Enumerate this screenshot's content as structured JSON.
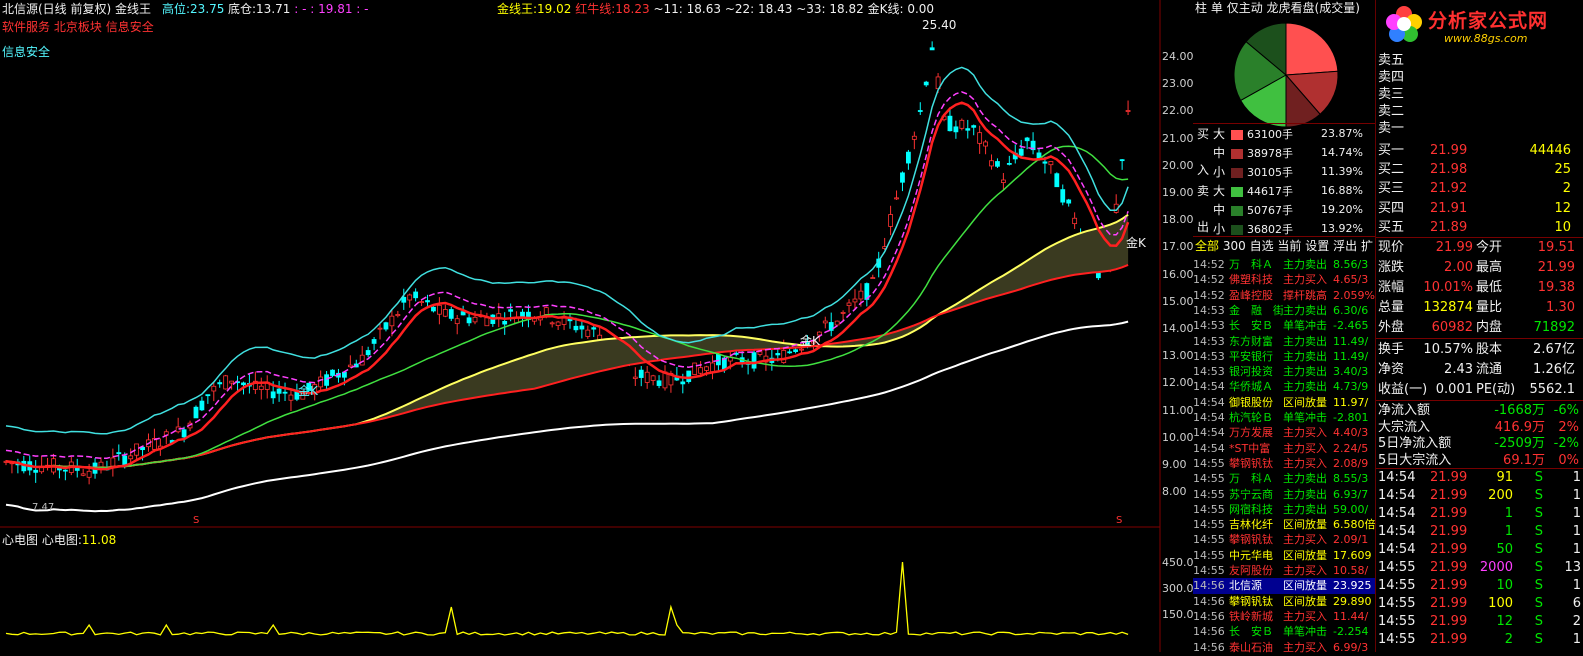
{
  "header": {
    "title": "北信源(日线 前复权) 金线王",
    "high_label": "高位:",
    "high_value": "23.75",
    "low_label": "底仓:",
    "low_value": "13.71",
    "dash_a": ": -",
    "v1981": ": 19.81",
    "dash_b": ": -",
    "gold_label": "金线王:",
    "gold_value": "19.02",
    "red_label": "红牛线:",
    "red_value": "18.23",
    "l11": "~11: 18.63",
    "l22": "~22: 18.43",
    "l33": "~33: 18.82",
    "goldk": "金K线: 0.00",
    "sectors": [
      "软件服务",
      "北京板块",
      "信息安全"
    ],
    "concept": "信息安全"
  },
  "chart": {
    "peak_label": "25.40",
    "low_mark": "7.47",
    "price_ticks": [
      "24.00",
      "23.00",
      "22.00",
      "21.00",
      "20.00",
      "19.00",
      "18.00",
      "17.00",
      "16.00",
      "15.00",
      "14.00",
      "13.00",
      "12.00",
      "11.00",
      "10.00",
      "9.00",
      "8.00"
    ],
    "goldk_labels": [
      "金K",
      "金K",
      "金K"
    ],
    "s_mark": "S",
    "indicator_title": "心电图",
    "indicator_label": "心电图:",
    "indicator_value": "11.08",
    "indicator_ticks": [
      "450.0",
      "300.0",
      "150.0"
    ]
  },
  "panel_tabs": [
    "柱",
    "单",
    "仅主动",
    "龙虎看盘(成交量)"
  ],
  "logo": {
    "name": "分析家公式网",
    "url": "www.88gs.com"
  },
  "money_flow": {
    "buy_side": [
      "买",
      "入"
    ],
    "sell_side": [
      "卖",
      "出"
    ],
    "rows": [
      {
        "size": "大",
        "vol": "63100手",
        "pct": "23.87%",
        "color": "#ff5050"
      },
      {
        "size": "中",
        "vol": "38978手",
        "pct": "14.74%",
        "color": "#b03030"
      },
      {
        "size": "小",
        "vol": "30105手",
        "pct": "11.39%",
        "color": "#702020"
      },
      {
        "size": "大",
        "vol": "44617手",
        "pct": "16.88%",
        "color": "#40c040"
      },
      {
        "size": "中",
        "vol": "50767手",
        "pct": "19.20%",
        "color": "#2a802a"
      },
      {
        "size": "小",
        "vol": "36802手",
        "pct": "13.92%",
        "color": "#1c501c"
      }
    ]
  },
  "filter_tabs": [
    "全部",
    "300",
    "自选",
    "当前",
    "设置",
    "浮出",
    "扩"
  ],
  "radar": [
    {
      "time": "14:52",
      "name": "万　科Ａ",
      "type": "主力卖出",
      "val": "8.56/3",
      "c": "green"
    },
    {
      "time": "14:52",
      "name": "佛塑科技",
      "type": "主力买入",
      "val": "4.65/3",
      "c": "red"
    },
    {
      "time": "14:52",
      "name": "盈峰控股",
      "type": "撑杆跳高",
      "val": "2.059%",
      "c": "red"
    },
    {
      "time": "14:53",
      "name": "金　融　街",
      "type": "主力卖出",
      "val": "6.30/6",
      "c": "green"
    },
    {
      "time": "14:53",
      "name": "长　安Ｂ",
      "type": "单笔冲击",
      "val": "-2.465",
      "c": "green"
    },
    {
      "time": "14:53",
      "name": "东方财富",
      "type": "主力卖出",
      "val": "11.49/",
      "c": "green"
    },
    {
      "time": "14:53",
      "name": "平安银行",
      "type": "主力卖出",
      "val": "11.49/",
      "c": "green"
    },
    {
      "time": "14:53",
      "name": "银河投资",
      "type": "主力卖出",
      "val": "3.40/3",
      "c": "green"
    },
    {
      "time": "14:54",
      "name": "华侨城Ａ",
      "type": "主力卖出",
      "val": "4.73/9",
      "c": "green"
    },
    {
      "time": "14:54",
      "name": "御银股份",
      "type": "区间放量",
      "val": "11.97/",
      "c": "yellow"
    },
    {
      "time": "14:54",
      "name": "杭汽轮Ｂ",
      "type": "单笔冲击",
      "val": "-2.801",
      "c": "green"
    },
    {
      "time": "14:54",
      "name": "万方发展",
      "type": "主力买入",
      "val": "4.40/3",
      "c": "red"
    },
    {
      "time": "14:54",
      "name": "*ST中富",
      "type": "主力买入",
      "val": "2.24/5",
      "c": "red"
    },
    {
      "time": "14:55",
      "name": "攀钢钒钛",
      "type": "主力买入",
      "val": "2.08/9",
      "c": "red"
    },
    {
      "time": "14:55",
      "name": "万　科Ａ",
      "type": "主力卖出",
      "val": "8.55/3",
      "c": "green"
    },
    {
      "time": "14:55",
      "name": "苏宁云商",
      "type": "主力卖出",
      "val": "6.93/7",
      "c": "green"
    },
    {
      "time": "14:55",
      "name": "网宿科技",
      "type": "主力卖出",
      "val": "59.00/",
      "c": "green"
    },
    {
      "time": "14:55",
      "name": "吉林化纤",
      "type": "区间放量",
      "val": "6.580倍",
      "c": "yellow"
    },
    {
      "time": "14:55",
      "name": "攀钢钒钛",
      "type": "主力买入",
      "val": "2.09/1",
      "c": "red"
    },
    {
      "time": "14:55",
      "name": "中元华电",
      "type": "区间放量",
      "val": "17.609",
      "c": "yellow"
    },
    {
      "time": "14:55",
      "name": "友阿股份",
      "type": "主力买入",
      "val": "10.58/",
      "c": "red"
    },
    {
      "time": "14:56",
      "name": "北信源",
      "type": "区间放量",
      "val": "23.925",
      "c": "yellow",
      "hl": true
    },
    {
      "time": "14:56",
      "name": "攀钢钒钛",
      "type": "区间放量",
      "val": "29.890",
      "c": "yellow"
    },
    {
      "time": "14:56",
      "name": "铁岭新城",
      "type": "主力买入",
      "val": "11.44/",
      "c": "red"
    },
    {
      "time": "14:56",
      "name": "长　安Ｂ",
      "type": "单笔冲击",
      "val": "-2.254",
      "c": "green"
    },
    {
      "time": "14:56",
      "name": "泰山石油",
      "type": "主力买入",
      "val": "6.99/3",
      "c": "red"
    }
  ],
  "order_book": {
    "asks": [
      {
        "label": "卖五",
        "price": "",
        "vol": ""
      },
      {
        "label": "卖四",
        "price": "",
        "vol": ""
      },
      {
        "label": "卖三",
        "price": "",
        "vol": ""
      },
      {
        "label": "卖二",
        "price": "",
        "vol": ""
      },
      {
        "label": "卖一",
        "price": "",
        "vol": ""
      }
    ],
    "bids": [
      {
        "label": "买一",
        "price": "21.99",
        "vol": "44446"
      },
      {
        "label": "买二",
        "price": "21.98",
        "vol": "25"
      },
      {
        "label": "买三",
        "price": "21.92",
        "vol": "2"
      },
      {
        "label": "买四",
        "price": "21.91",
        "vol": "12"
      },
      {
        "label": "买五",
        "price": "21.89",
        "vol": "10"
      }
    ]
  },
  "quote": [
    [
      {
        "l": "现价",
        "v": "21.99",
        "c": "red"
      },
      {
        "l": "今开",
        "v": "19.51",
        "c": "red"
      }
    ],
    [
      {
        "l": "涨跌",
        "v": "2.00",
        "c": "red"
      },
      {
        "l": "最高",
        "v": "21.99",
        "c": "red"
      }
    ],
    [
      {
        "l": "涨幅",
        "v": "10.01%",
        "c": "red"
      },
      {
        "l": "最低",
        "v": "19.38",
        "c": "red"
      }
    ],
    [
      {
        "l": "总量",
        "v": "132874",
        "c": "yellow"
      },
      {
        "l": "量比",
        "v": "1.30",
        "c": "red"
      }
    ],
    [
      {
        "l": "外盘",
        "v": "60982",
        "c": "red"
      },
      {
        "l": "内盘",
        "v": "71892",
        "c": "green"
      }
    ]
  ],
  "fundamentals": [
    [
      {
        "l": "换手",
        "v": "10.57%"
      },
      {
        "l": "股本",
        "v": "2.67亿"
      }
    ],
    [
      {
        "l": "净资",
        "v": "2.43"
      },
      {
        "l": "流通",
        "v": "1.26亿"
      }
    ],
    [
      {
        "l": "收益(一)",
        "v": "0.001"
      },
      {
        "l": "PE(动)",
        "v": "5562.1"
      }
    ]
  ],
  "flows": [
    {
      "l": "净流入额",
      "v": "-1668万",
      "p": "-6%",
      "c": "green"
    },
    {
      "l": "大宗流入",
      "v": "416.9万",
      "p": "2%",
      "c": "red"
    },
    {
      "l": "5日净流入额",
      "v": "-2509万",
      "p": "-2%",
      "c": "green"
    },
    {
      "l": "5日大宗流入",
      "v": "69.1万",
      "p": "0%",
      "c": "red"
    }
  ],
  "trades": [
    {
      "t": "14:54",
      "p": "21.99",
      "v": "91",
      "s": "S",
      "n": "1",
      "vc": "yellow"
    },
    {
      "t": "14:54",
      "p": "21.99",
      "v": "200",
      "s": "S",
      "n": "1",
      "vc": "yellow"
    },
    {
      "t": "14:54",
      "p": "21.99",
      "v": "1",
      "s": "S",
      "n": "1",
      "vc": "green"
    },
    {
      "t": "14:54",
      "p": "21.99",
      "v": "1",
      "s": "S",
      "n": "1",
      "vc": "green"
    },
    {
      "t": "14:54",
      "p": "21.99",
      "v": "50",
      "s": "S",
      "n": "1",
      "vc": "green"
    },
    {
      "t": "14:55",
      "p": "21.99",
      "v": "2000",
      "s": "S",
      "n": "13",
      "vc": "purple"
    },
    {
      "t": "14:55",
      "p": "21.99",
      "v": "10",
      "s": "S",
      "n": "1",
      "vc": "green"
    },
    {
      "t": "14:55",
      "p": "21.99",
      "v": "100",
      "s": "S",
      "n": "6",
      "vc": "yellow"
    },
    {
      "t": "14:55",
      "p": "21.99",
      "v": "12",
      "s": "S",
      "n": "2",
      "vc": "green"
    },
    {
      "t": "14:55",
      "p": "21.99",
      "v": "2",
      "s": "S",
      "n": "1",
      "vc": "green"
    }
  ],
  "colors": {
    "up": "#ff3232",
    "down": "#00e600",
    "gold": "#ffff00",
    "cyan": "#54f7ff",
    "magenta": "#ff40ff",
    "bg": "#000000"
  }
}
